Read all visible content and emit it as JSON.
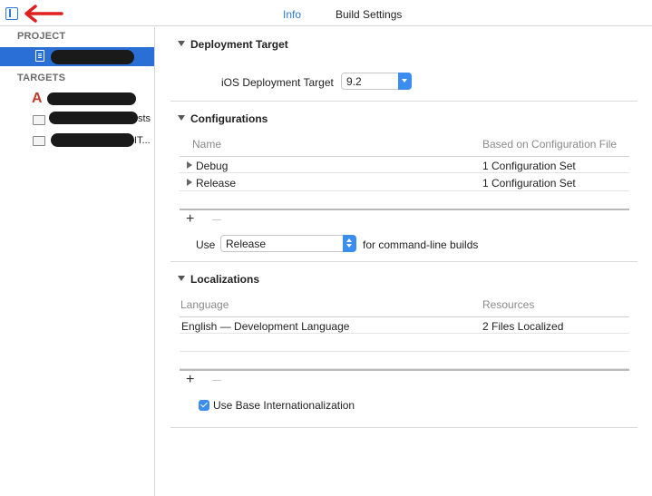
{
  "tabs": {
    "info": "Info",
    "build_settings": "Build Settings"
  },
  "sidebar": {
    "project_heading": "PROJECT",
    "targets_heading": "TARGETS",
    "targets": [
      {
        "tail": ""
      },
      {
        "tail": "sts"
      },
      {
        "tail": "IT..."
      }
    ]
  },
  "deployment": {
    "title": "Deployment Target",
    "ios_label": "iOS Deployment Target",
    "ios_value": "9.2"
  },
  "configurations": {
    "title": "Configurations",
    "col_name": "Name",
    "col_based_on": "Based on Configuration File",
    "rows": [
      {
        "name": "Debug",
        "based_on": "1 Configuration Set"
      },
      {
        "name": "Release",
        "based_on": "1 Configuration Set"
      }
    ],
    "add": "+",
    "use_label": "Use",
    "use_value": "Release",
    "use_suffix": "for command-line builds"
  },
  "localizations": {
    "title": "Localizations",
    "col_language": "Language",
    "col_resources": "Resources",
    "rows": [
      {
        "language": "English — Development Language",
        "resources": "2 Files Localized"
      }
    ],
    "add": "+",
    "base_i18n_label": "Use Base Internationalization",
    "base_i18n_checked": true
  },
  "colors": {
    "accent": "#2a7bd6",
    "selection": "#2a6fd6",
    "annotation_arrow": "#e02020"
  }
}
